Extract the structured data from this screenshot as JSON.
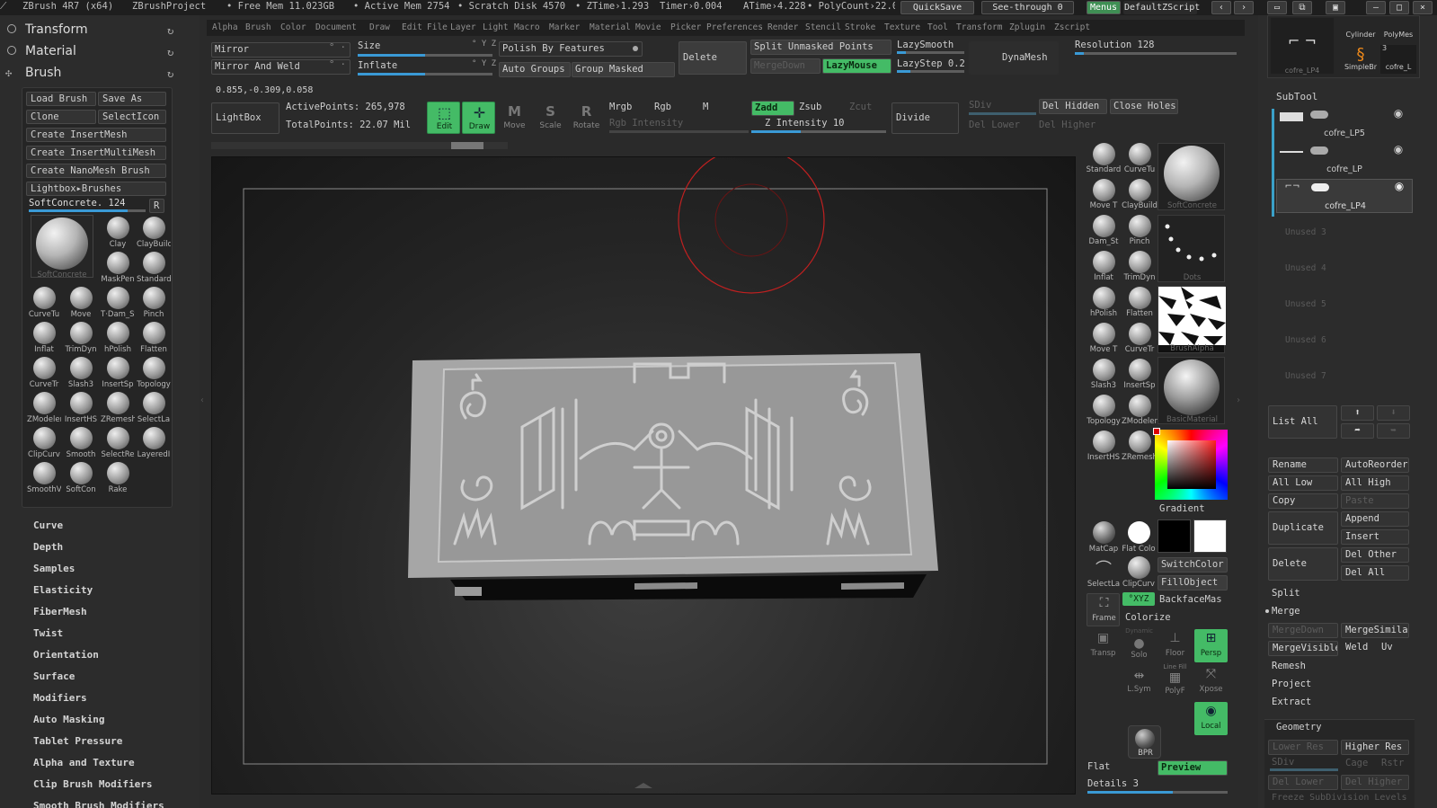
{
  "titlebar": {
    "app": "ZBrush 4R7 (x64)",
    "project": "ZBrushProject",
    "free_mem": "• Free Mem 11.023GB",
    "active_mem": "• Active Mem 2754",
    "scratch": "• Scratch Disk 4570",
    "ztime": "• ZTime›1.293",
    "timer": "Timer›0.004",
    "atime": "ATime›4.228",
    "polycount": "• PolyCount›22.0",
    "quicksave": "QuickSave",
    "seethrough": "See-through  0",
    "menus": "Menus",
    "script": "DefaultZScript"
  },
  "menubar": [
    "Alpha",
    "Brush",
    "Color",
    "Document",
    "Draw",
    "Edit",
    "File",
    "Layer",
    "Light",
    "Macro",
    "Marker",
    "Material",
    "Movie",
    "Picker",
    "Preferences",
    "Render",
    "Stencil",
    "Stroke",
    "Texture",
    "Tool",
    "Transform",
    "Zplugin",
    "Zscript"
  ],
  "left": {
    "palettes": [
      "Transform",
      "Material",
      "Brush"
    ],
    "buttons": {
      "load_brush": "Load Brush",
      "save_as": "Save As",
      "clone": "Clone",
      "select_icon": "SelectIcon",
      "create_insertmesh": "Create InsertMesh",
      "create_insertmultimesh": "Create InsertMultiMesh",
      "create_nanomesh": "Create NanoMesh Brush",
      "lightbox_brushes": "Lightbox▸Brushes"
    },
    "current_brush": "SoftConcrete. 124",
    "r_button": "R",
    "current_brush_caption": "SoftConcrete",
    "brushes": [
      "Clay",
      "ClayBuild",
      "MaskPen",
      "Standard",
      "CurveTu",
      "Move",
      "T·Dam_St",
      "Pinch",
      "Inflat",
      "TrimDyn",
      "hPolish",
      "Flatten",
      "CurveTr",
      "Slash3",
      "InsertSp",
      "Topology",
      "ZModeler",
      "InsertHS",
      "ZRemesh",
      "SelectLa",
      "ClipCurv",
      "Smooth",
      "SelectRe",
      "LayeredI",
      "SmoothV",
      "SoftCon",
      "Rake"
    ],
    "subpalettes": [
      "Curve",
      "Depth",
      "Samples",
      "Elasticity",
      "FiberMesh",
      "Twist",
      "Orientation",
      "Surface",
      "Modifiers",
      "Auto Masking",
      "Tablet Pressure",
      "Alpha and Texture",
      "Clip Brush Modifiers",
      "Smooth Brush Modifiers"
    ]
  },
  "toolbar": {
    "mirror": "Mirror",
    "mirror_weld": "Mirror And Weld",
    "size": "Size",
    "inflate": "Inflate",
    "xyz": "° Y Z",
    "polish_features": "Polish By Features",
    "auto_groups": "Auto Groups",
    "group_masked": "Group Masked",
    "delete": "Delete",
    "split_unmasked": "Split Unmasked Points",
    "merge_down": "MergeDown",
    "lazy_mouse": "LazyMouse",
    "lazy_smooth": "LazySmooth",
    "lazy_step": "LazyStep 0.2",
    "dynamesh": "DynaMesh",
    "resolution": "Resolution 128",
    "coords": "0.855,-0.309,0.058",
    "lightbox": "LightBox",
    "active_points": "ActivePoints: 265,978",
    "total_points": "TotalPoints: 22.07 Mil",
    "edit": "Edit",
    "draw": "Draw",
    "move": "Move",
    "scale": "Scale",
    "rotate": "Rotate",
    "mrgb": "Mrgb",
    "rgb": "Rgb",
    "m": "M",
    "rgb_intensity": "Rgb Intensity",
    "zadd": "Zadd",
    "zsub": "Zsub",
    "zcut": "Zcut",
    "z_intensity": "Z Intensity 10",
    "divide": "Divide",
    "sdiv": "SDiv",
    "del_lower": "Del Lower",
    "del_hidden": "Del Hidden",
    "close_holes": "Close Holes",
    "del_higher": "Del Higher"
  },
  "shelf": {
    "icons": [
      "Standard",
      "CurveTu",
      "Move T",
      "ClayBuild",
      "Dam_St",
      "Pinch",
      "Inflat",
      "TrimDyn",
      "hPolish",
      "Flatten",
      "Move T",
      "CurveTr",
      "Slash3",
      "InsertSp",
      "Topology",
      "ZModeler",
      "InsertHS",
      "ZRemesh"
    ],
    "tiles": [
      "SoftConcrete",
      "Dots",
      "BrushAlpha",
      "BasicMaterial"
    ],
    "gradient": "Gradient",
    "matcap": "MatCap",
    "flat_color": "Flat Colo",
    "switch_color": "SwitchColor",
    "fill_object": "FillObject",
    "backface": "BackfaceMas",
    "colorize": "Colorize",
    "selectla": "SelectLa",
    "clipcurv": "ClipCurv",
    "frame": "Frame",
    "transp": "Transp",
    "solo": "Solo",
    "floor": "Floor",
    "persp": "Persp",
    "lsym": "L.Sym",
    "polyf": "PolyF",
    "xpose": "Xpose",
    "local": "Local",
    "bpr": "BPR",
    "xyz": "°XYZ",
    "dynamic": "Dynamic",
    "line_fill": "Line Fill",
    "flat": "Flat",
    "preview": "Preview",
    "details": "Details 3",
    "accent": "#44bb66"
  },
  "right": {
    "tools_top": [
      "Cylinder",
      "PolyMes",
      "SimpleBr",
      "cofre_L"
    ],
    "tool_count": "3",
    "tool_caption": "cofre_LP4",
    "subtool_title": "SubTool",
    "subtools": [
      "cofre_LP5",
      "cofre_LP",
      "cofre_LP4"
    ],
    "unused": [
      "Unused 3",
      "Unused 4",
      "Unused 5",
      "Unused 6",
      "Unused 7"
    ],
    "list_all": "List  All",
    "rename": "Rename",
    "autoreorder": "AutoReorder",
    "all_low": "All Low",
    "all_high": "All High",
    "copy": "Copy",
    "paste": "Paste",
    "duplicate": "Duplicate",
    "append": "Append",
    "insert": "Insert",
    "delete": "Delete",
    "del_other": "Del Other",
    "del_all": "Del  All",
    "split": "Split",
    "merge": "Merge",
    "mergedown": "MergeDown",
    "mergesimilar": "MergeSimilar",
    "mergevisible": "MergeVisible",
    "weld": "Weld",
    "uv": "Uv",
    "remesh": "Remesh",
    "project": "Project",
    "extract": "Extract",
    "geometry": "Geometry",
    "lower_res": "Lower Res",
    "higher_res": "Higher Res",
    "sdiv": "SDiv",
    "cage": "Cage",
    "rstr": "Rstr",
    "del_lower": "Del Lower",
    "del_higher": "Del Higher",
    "freeze": "Freeze SubDivision Levels"
  },
  "viewport": {
    "background": "#2a2a2a",
    "model_color": "#a9a9a9",
    "cursor_color": "#c02020"
  }
}
